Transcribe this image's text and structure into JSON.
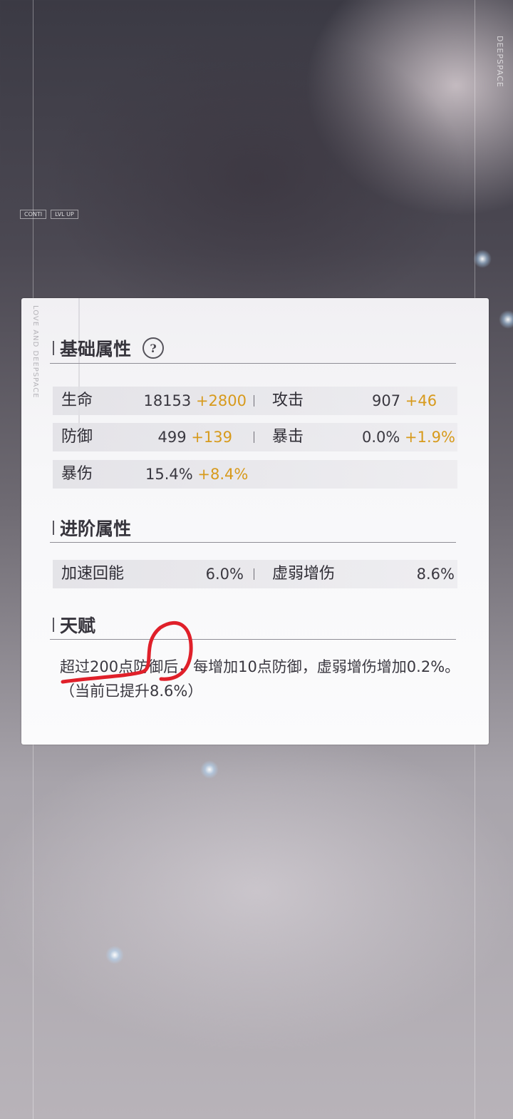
{
  "brand_vertical": "DEEPSPACE",
  "hud": {
    "tag_left": "CONTI",
    "tag_right": "LVL UP"
  },
  "panel": {
    "deco_text": "LOVE AND DEEPSPACE",
    "basic": {
      "title": "基础属性",
      "help_icon": "?",
      "stats": [
        {
          "label": "生命",
          "value": "18153",
          "bonus": "+2800"
        },
        {
          "label": "攻击",
          "value": "907",
          "bonus": "+46"
        },
        {
          "label": "防御",
          "value": "499",
          "bonus": "+139"
        },
        {
          "label": "暴击",
          "value": "0.0%",
          "bonus": "+1.9%"
        },
        {
          "label": "暴伤",
          "value": "15.4%",
          "bonus": "+8.4%"
        }
      ]
    },
    "advanced": {
      "title": "进阶属性",
      "stats": [
        {
          "label": "加速回能",
          "value": "6.0%"
        },
        {
          "label": "虚弱增伤",
          "value": "8.6%"
        }
      ]
    },
    "talent": {
      "title": "天赋",
      "text": "超过200点防御后，每增加10点防御，虚弱增伤增加0.2%。（当前已提升8.6%）"
    }
  },
  "colors": {
    "bonus": "#d79a1c",
    "annotation": "#e0202a"
  }
}
